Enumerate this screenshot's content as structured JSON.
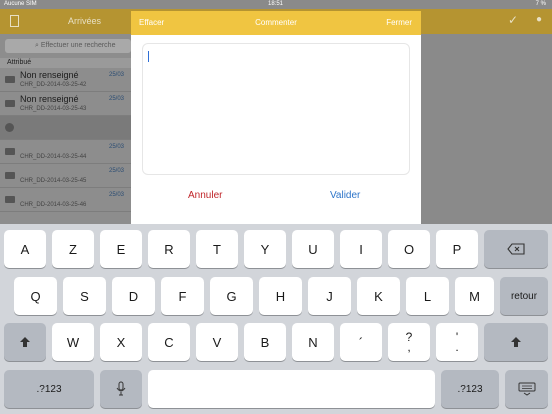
{
  "status": {
    "carrier": "Aucune SIM",
    "time": "18:51",
    "battery": "7 %"
  },
  "app": {
    "title": "Arrivées",
    "search_placeholder": "Effectuer une recherche",
    "section": "Attribué",
    "rows": [
      {
        "title": "Non renseigné",
        "sub": "CHR_DD-2014-03-25-42",
        "date": "25/03"
      },
      {
        "title": "Non renseigné",
        "sub": "CHR_DD-2014-03-25-43",
        "date": "25/03"
      },
      {
        "title": "",
        "sub": "",
        "date": ""
      },
      {
        "title": "",
        "sub": "CHR_DD-2014-03-25-44",
        "date": "25/03"
      },
      {
        "title": "",
        "sub": "CHR_DD-2014-03-25-45",
        "date": "25/03"
      },
      {
        "title": "",
        "sub": "CHR_DD-2014-03-25-46",
        "date": "25/03"
      }
    ]
  },
  "modal": {
    "left": "Effacer",
    "title": "Commenter",
    "right": "Fermer",
    "comment_value": "",
    "cancel": "Annuler",
    "validate": "Valider"
  },
  "keyboard": {
    "row1": [
      "A",
      "Z",
      "E",
      "R",
      "T",
      "Y",
      "U",
      "I",
      "O",
      "P"
    ],
    "row2": [
      "Q",
      "S",
      "D",
      "F",
      "G",
      "H",
      "J",
      "K",
      "L",
      "M"
    ],
    "row3": [
      "W",
      "X",
      "C",
      "V",
      "B",
      "N",
      "´"
    ],
    "question_top": "?",
    "question_bottom": ",",
    "apos_top": "'",
    "apos_bottom": ".",
    "return": "retour",
    "numbers": ".?123",
    "numbers2": ".?123"
  }
}
